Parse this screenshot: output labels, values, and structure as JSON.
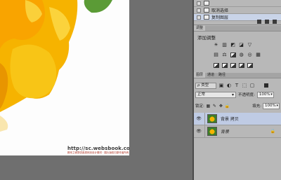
{
  "canvas": {
    "url_text": "http://sc.websbook.com",
    "watermark_text": "脚本之家提供各类网页设计素材 · 图片版权归原作者所有"
  },
  "history": {
    "items": [
      {
        "label": ""
      },
      {
        "label": "取消选择"
      },
      {
        "label": "复制图层"
      }
    ]
  },
  "adjustments": {
    "tab": "调整",
    "title": "添加调整"
  },
  "layers_panel": {
    "tabs": [
      "图层",
      "通道",
      "路径"
    ],
    "kind_label": "ρ 类型",
    "blend_mode": "正常",
    "opacity_label": "不透明度:",
    "opacity_value": "100%",
    "lock_label": "锁定:",
    "fill_label": "填充:",
    "fill_value": "100%",
    "layers": [
      {
        "name": "背景 拷贝",
        "selected": true
      },
      {
        "name": "背景",
        "locked": true
      }
    ]
  },
  "colors": {
    "flower": "#f7b500",
    "leaf": "#4f8d2e",
    "panel": "#b8b8b8",
    "selection": "#bfcbe4"
  }
}
